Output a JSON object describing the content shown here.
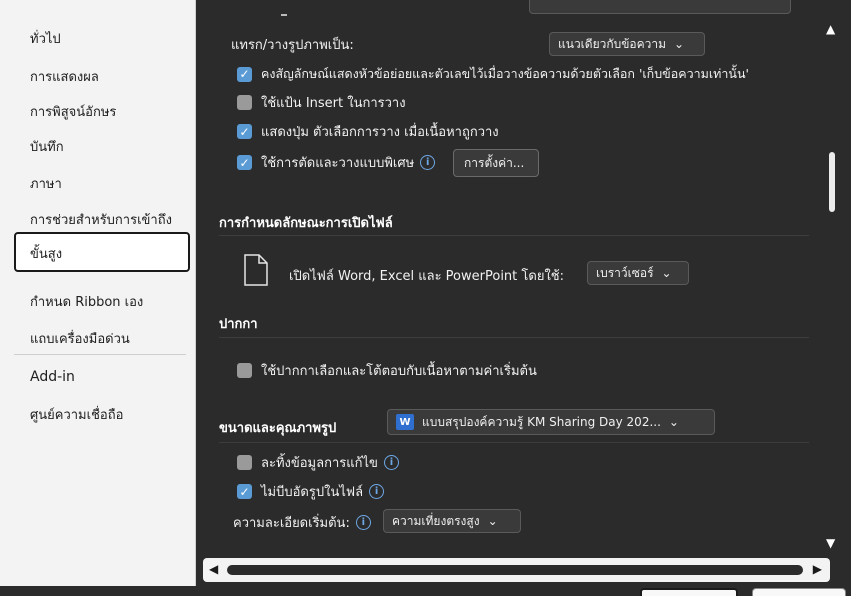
{
  "sidebar": {
    "items": [
      {
        "label": "ทั่วไป"
      },
      {
        "label": "การแสดงผล"
      },
      {
        "label": "การพิสูจน์อักษร"
      },
      {
        "label": "บันทึก"
      },
      {
        "label": "ภาษา"
      },
      {
        "label": "การช่วยสำหรับการเข้าถึง"
      },
      {
        "label": "ขั้นสูง"
      },
      {
        "label": "กำหนด Ribbon เอง"
      },
      {
        "label": "แถบเครื่องมือด่วน"
      },
      {
        "label": "Add-in"
      },
      {
        "label": "ศูนย์ความเชื่อถือ"
      }
    ],
    "selected": "ขั้นสูง"
  },
  "paste": {
    "insert_as_label": "แทรก/วางรูปภาพเป็น:",
    "insert_as_value": "แนวเดียวกับข้อความ",
    "options": [
      {
        "label": "คงสัญลักษณ์แสดงหัวข้อย่อยและตัวเลขไว้เมื่อวางข้อความด้วยตัวเลือก 'เก็บข้อความเท่านั้น'",
        "checked": true
      },
      {
        "label": "ใช้แป้น Insert ในการวาง",
        "checked": false
      },
      {
        "label": "แสดงปุ่ม ตัวเลือกการวาง เมื่อเนื้อหาถูกวาง",
        "checked": true
      },
      {
        "label": "ใช้การตัดและวางแบบพิเศษ",
        "checked": true
      }
    ],
    "settings_button": "การตั้งค่า..."
  },
  "file_open": {
    "section_title": "การกำหนดลักษณะการเปิดไฟล์",
    "open_label": "เปิดไฟล์ Word, Excel และ PowerPoint โดยใช้:",
    "open_value": "เบราว์เซอร์"
  },
  "pen": {
    "section_title": "ปากกา",
    "option_label": "ใช้ปากกาเลือกและโต้ตอบกับเนื้อหาตามค่าเริ่มต้น",
    "checked": false
  },
  "image_size": {
    "section_title": "ขนาดและคุณภาพรูป",
    "doc_value": "แบบสรุปองค์ความรู้ KM Sharing Day 202...",
    "options": [
      {
        "label": "ละทิ้งข้อมูลการแก้ไข",
        "checked": false
      },
      {
        "label": "ไม่บีบอัดรูปในไฟล์",
        "checked": true
      }
    ],
    "resolution_label": "ความละเอียดเริ่มต้น:",
    "resolution_value": "ความเที่ยงตรงสูง"
  },
  "icons": {
    "checkmark": "✓",
    "chevron": "⌄",
    "info": "i",
    "up_arrow": "▲",
    "down_arrow": "▼",
    "left_arrow": "◀",
    "right_arrow": "▶"
  },
  "colors": {
    "checkbox_on": "#5b9bd5",
    "panel_bg": "#2b2b2b",
    "sidebar_bg": "#f3f3f3"
  }
}
